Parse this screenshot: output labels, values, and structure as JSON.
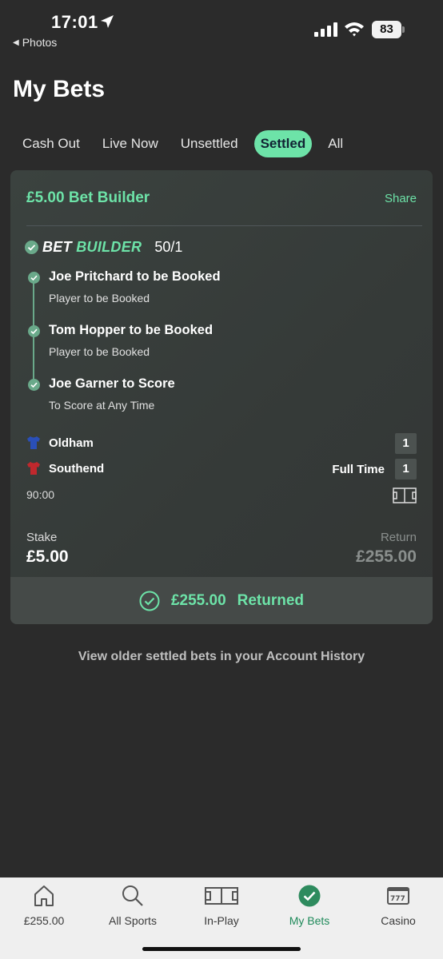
{
  "status_bar": {
    "time": "17:01",
    "back_label": "Photos",
    "battery_level": "83"
  },
  "page": {
    "title": "My Bets"
  },
  "tabs": [
    {
      "label": "Cash Out",
      "active": false
    },
    {
      "label": "Live Now",
      "active": false
    },
    {
      "label": "Unsettled",
      "active": false
    },
    {
      "label": "Settled",
      "active": true
    },
    {
      "label": "All",
      "active": false
    }
  ],
  "bet": {
    "title": "£5.00 Bet Builder",
    "share_label": "Share",
    "builder_word1": "BET",
    "builder_word2": "BUILDER",
    "odds": "50/1",
    "legs": [
      {
        "selection": "Joe Pritchard to be Booked",
        "market": "Player to be Booked"
      },
      {
        "selection": "Tom Hopper to be Booked",
        "market": "Player to be Booked"
      },
      {
        "selection": "Joe Garner to Score",
        "market": "To Score at Any Time"
      }
    ],
    "home_team": {
      "name": "Oldham",
      "score": "1",
      "shirt_color": "#2a4fb8"
    },
    "away_team": {
      "name": "Southend",
      "score": "1",
      "shirt_color": "#c0282d"
    },
    "status": "Full Time",
    "clock": "90:00",
    "stake_label": "Stake",
    "stake_value": "£5.00",
    "return_label": "Return",
    "return_value": "£255.00",
    "returned_amount": "£255.00",
    "returned_label": "Returned"
  },
  "history_link": "View older settled bets in your Account History",
  "bottom_nav": [
    {
      "label": "£255.00",
      "icon": "home-icon",
      "active": false
    },
    {
      "label": "All Sports",
      "icon": "search-icon",
      "active": false
    },
    {
      "label": "In-Play",
      "icon": "pitch-icon",
      "active": false
    },
    {
      "label": "My Bets",
      "icon": "check-circle-icon",
      "active": true
    },
    {
      "label": "Casino",
      "icon": "slot-machine-icon",
      "active": false
    }
  ],
  "colors": {
    "accent": "#6de3a8",
    "background": "#2b2b2b",
    "card": "#383d3b",
    "nav_active": "#1f8a5a"
  }
}
